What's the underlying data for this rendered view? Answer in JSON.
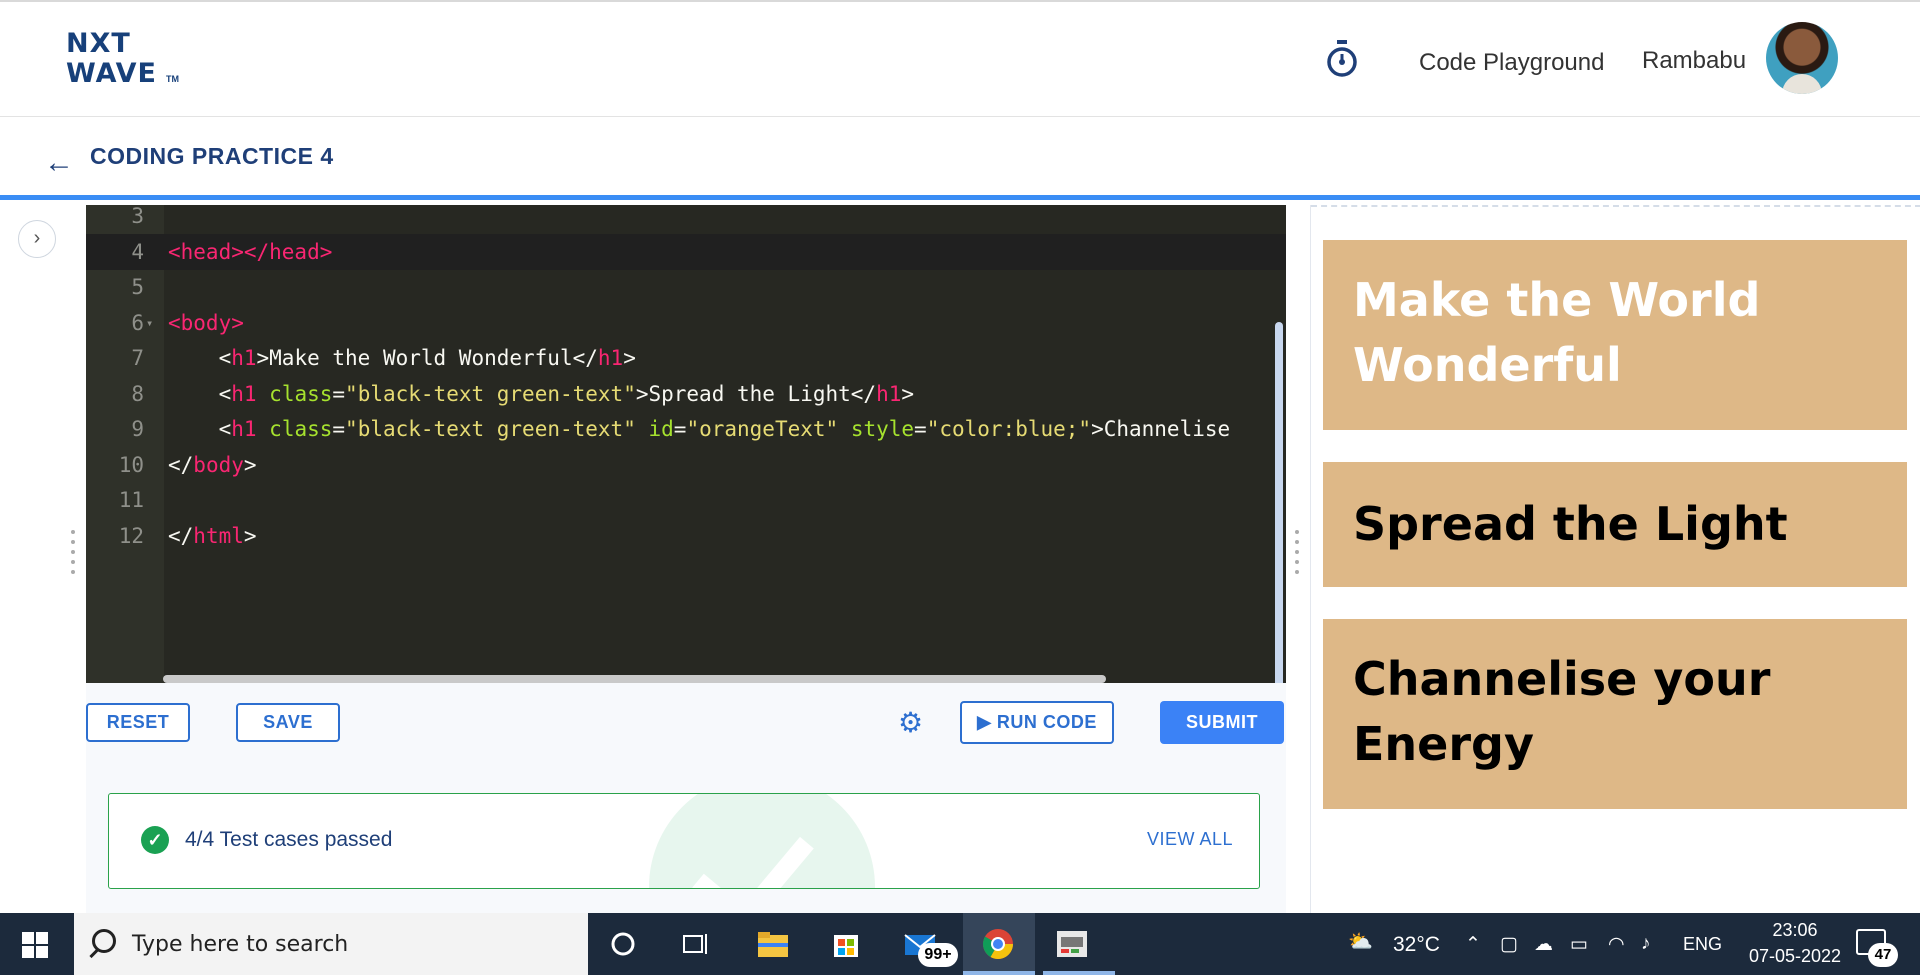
{
  "header": {
    "logo_line1": "NXT",
    "logo_line2": "WAVE",
    "logo_tm": "TM",
    "playground_label": "Code Playground",
    "username": "Rambabu"
  },
  "subheader": {
    "back_icon": "←",
    "title": "CODING PRACTICE 4"
  },
  "editor": {
    "lines": [
      {
        "num": "3",
        "fold": "",
        "parts": []
      },
      {
        "num": "4",
        "fold": "",
        "parts": [
          [
            "tag",
            "<head></head>"
          ]
        ]
      },
      {
        "num": "5",
        "fold": "",
        "parts": []
      },
      {
        "num": "6",
        "fold": "▾",
        "parts": [
          [
            "tag",
            "<body>"
          ]
        ]
      },
      {
        "num": "7",
        "fold": "",
        "parts": [
          [
            "plain",
            "    <"
          ],
          [
            "tag",
            "h1"
          ],
          [
            "plain",
            ">Make the World Wonderful</"
          ],
          [
            "tag",
            "h1"
          ],
          [
            "plain",
            ">"
          ]
        ]
      },
      {
        "num": "8",
        "fold": "",
        "parts": [
          [
            "plain",
            "    <"
          ],
          [
            "tag",
            "h1"
          ],
          [
            "plain",
            " "
          ],
          [
            "attr",
            "class"
          ],
          [
            "plain",
            "="
          ],
          [
            "str",
            "\"black-text green-text\""
          ],
          [
            "plain",
            ">Spread the Light</"
          ],
          [
            "tag",
            "h1"
          ],
          [
            "plain",
            ">"
          ]
        ]
      },
      {
        "num": "9",
        "fold": "",
        "parts": [
          [
            "plain",
            "    <"
          ],
          [
            "tag",
            "h1"
          ],
          [
            "plain",
            " "
          ],
          [
            "attr",
            "class"
          ],
          [
            "plain",
            "="
          ],
          [
            "str",
            "\"black-text green-text\""
          ],
          [
            "plain",
            " "
          ],
          [
            "attr",
            "id"
          ],
          [
            "plain",
            "="
          ],
          [
            "str",
            "\"orangeText\""
          ],
          [
            "plain",
            " "
          ],
          [
            "attr",
            "style"
          ],
          [
            "plain",
            "="
          ],
          [
            "str",
            "\"color:blue;\""
          ],
          [
            "plain",
            ">Channelise"
          ]
        ]
      },
      {
        "num": "10",
        "fold": "",
        "parts": [
          [
            "plain",
            "</"
          ],
          [
            "tag",
            "body"
          ],
          [
            "plain",
            ">"
          ]
        ]
      },
      {
        "num": "11",
        "fold": "",
        "parts": []
      },
      {
        "num": "12",
        "fold": "",
        "parts": [
          [
            "plain",
            "</"
          ],
          [
            "tag",
            "html"
          ],
          [
            "plain",
            ">"
          ]
        ]
      }
    ]
  },
  "actions": {
    "reset": "RESET",
    "save": "SAVE",
    "run": "▶ RUN CODE",
    "submit": "SUBMIT"
  },
  "tests": {
    "status": "4/4 Test cases passed",
    "view_all": "VIEW ALL"
  },
  "output": {
    "heading1": "Make the World Wonderful",
    "heading2": "Spread the Light",
    "heading3": "Channelise your Energy",
    "card_color": "#deb887"
  },
  "taskbar": {
    "search_placeholder": "Type here to search",
    "mail_badge": "99+",
    "temperature": "32°C",
    "language": "ENG",
    "time": "23:06",
    "date": "07-05-2022",
    "notifications": "47"
  },
  "colors": {
    "brand": "#1f3f78",
    "accent": "#3b82f6",
    "success": "#1aa153",
    "editor_bg": "#272822"
  }
}
